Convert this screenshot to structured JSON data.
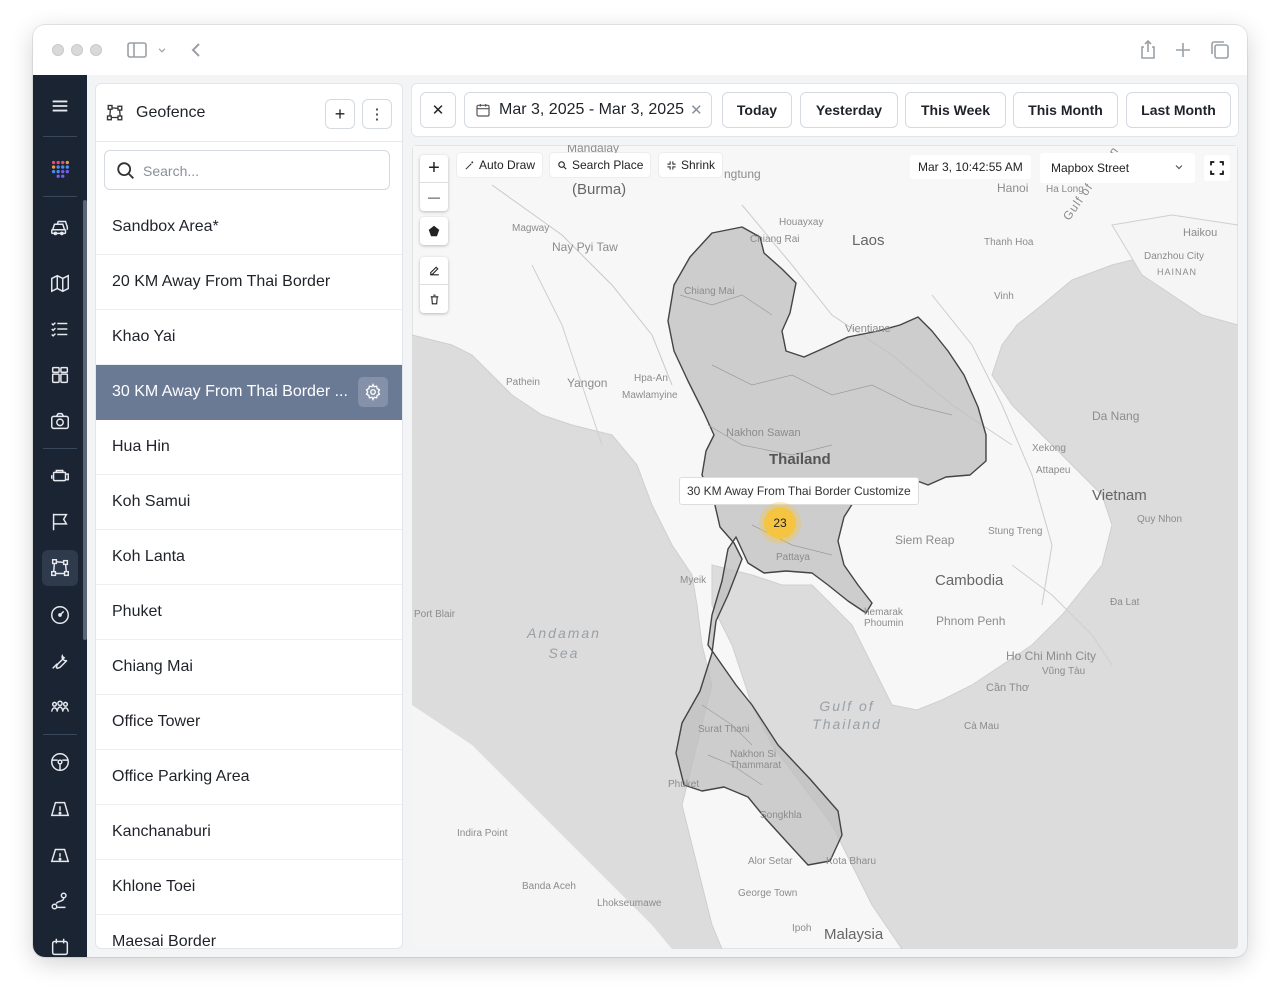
{
  "panel": {
    "title": "Geofence",
    "add_label": "+",
    "more_label": "⋮",
    "search_placeholder": "Search...",
    "items": [
      {
        "label": "Sandbox Area*"
      },
      {
        "label": "20 KM Away From Thai Border"
      },
      {
        "label": "Khao Yai"
      },
      {
        "label": "30 KM Away From Thai Border ...",
        "selected": true
      },
      {
        "label": "Hua Hin"
      },
      {
        "label": "Koh Samui"
      },
      {
        "label": "Koh Lanta"
      },
      {
        "label": "Phuket"
      },
      {
        "label": "Chiang Mai"
      },
      {
        "label": "Office Tower"
      },
      {
        "label": "Office Parking Area"
      },
      {
        "label": "Kanchanaburi"
      },
      {
        "label": "Khlone Toei"
      },
      {
        "label": "Maesai Border"
      }
    ]
  },
  "toolbar": {
    "close_label": "✕",
    "date_range": "Mar 3, 2025 - Mar 3, 2025",
    "clear_label": "✕",
    "buttons": [
      "Today",
      "Yesterday",
      "This Week",
      "This Month",
      "Last Month"
    ]
  },
  "map": {
    "zoom_in": "+",
    "zoom_out": "—",
    "tools": {
      "auto_draw": "Auto Draw",
      "search_place": "Search Place",
      "shrink": "Shrink"
    },
    "timestamp": "Mar 3, 10:42:55 AM",
    "style_selected": "Mapbox Street",
    "tooltip": "30 KM Away From Thai Border Customize",
    "cluster_count": "23",
    "labels": {
      "burma": "(Burma)",
      "laos": "Laos",
      "thailand": "Thailand",
      "cambodia": "Cambodia",
      "vietnam": "Vietnam",
      "malaysia": "Malaysia",
      "andaman_sea": "Andaman Sea",
      "gulf_thailand": "Gulf of Thailand",
      "gulf_tonkin": "Gulf of Tonkin",
      "hanoi": "Hanoi",
      "ha_long": "Ha Long",
      "haikou": "Haikou",
      "danzhou": "Danzhou City",
      "hainan": "HAINAN",
      "magway": "Magway",
      "nay_pyi_taw": "Nay Pyi Taw",
      "chiang_mai": "Chiang Mai",
      "chiang_rai": "Chiang Rai",
      "houayxay": "Houayxay",
      "thanh_hoa": "Thanh Hoa",
      "vinh": "Vinh",
      "vientiane": "Vientiane",
      "pathein": "Pathein",
      "yangon": "Yangon",
      "hpa_an": "Hpa-An",
      "mawlamyine": "Mawlamyine",
      "nakhon_sawan": "Nakhon Sawan",
      "da_nang": "Da Nang",
      "xekong": "Xekong",
      "attapeu": "Attapeu",
      "quy_nhon": "Quy Nhon",
      "stung_treng": "Stung Treng",
      "siem_reap": "Siem Reap",
      "pattaya": "Pattaya",
      "myeik": "Myeik",
      "port_blair": "Port Blair",
      "phnom_penh": "Phnom Penh",
      "chemarak": "hemarak Phoumin",
      "da_lat": "Đa Lat",
      "ho_chi_minh": "Ho Chi Minh City",
      "vung_tau": "Vũng Tàu",
      "can_tho": "Cần Thơ",
      "ca_mau": "Cà Mau",
      "surat_thani": "Surat Thani",
      "nakhon_si": "Nakhon Si Thammarat",
      "phuket": "Phuket",
      "songkhla": "Songkhla",
      "indira_point": "Indira Point",
      "alor_setar": "Alor Setar",
      "kota_bharu": "Kota Bharu",
      "banda_aceh": "Banda Aceh",
      "george_town": "George Town",
      "lhokseumawe": "Lhokseumawe",
      "ipoh": "Ipoh",
      "mandalay": "Mandalay",
      "jinghong": "ngtung"
    }
  }
}
